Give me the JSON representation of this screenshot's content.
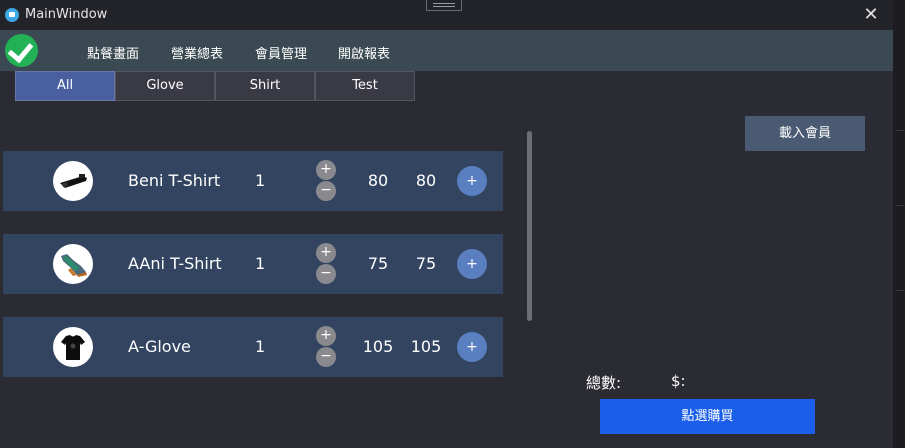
{
  "window": {
    "title": "MainWindow",
    "close_glyph": "✕"
  },
  "menubar": {
    "logo_icon": "check-circle-icon",
    "items": [
      "點餐畫面",
      "營業總表",
      "會員管理",
      "開啟報表"
    ]
  },
  "tabs": [
    {
      "label": "All",
      "active": true
    },
    {
      "label": "Glove",
      "active": false
    },
    {
      "label": "Shirt",
      "active": false
    },
    {
      "label": "Test",
      "active": false
    }
  ],
  "load_member_button": "載入會員",
  "products": [
    {
      "name": "Beni T-Shirt",
      "qty": "1",
      "unit_price": "80",
      "subtotal": "80",
      "image_icon": "glove-icon",
      "plus": "+",
      "minus": "−",
      "add": "+"
    },
    {
      "name": "AAni T-Shirt",
      "qty": "1",
      "unit_price": "75",
      "subtotal": "75",
      "image_icon": "shoe-icon",
      "plus": "+",
      "minus": "−",
      "add": "+"
    },
    {
      "name": "A-Glove",
      "qty": "1",
      "unit_price": "105",
      "subtotal": "105",
      "image_icon": "tshirt-icon",
      "plus": "+",
      "minus": "−",
      "add": "+"
    }
  ],
  "summary": {
    "total_label": "總數:",
    "amount_label": "$:"
  },
  "buy_button": "點選購買",
  "colors": {
    "accent_tab": "#4a5fa0",
    "buy_button": "#1a5eea",
    "row_bg": "#324460"
  }
}
